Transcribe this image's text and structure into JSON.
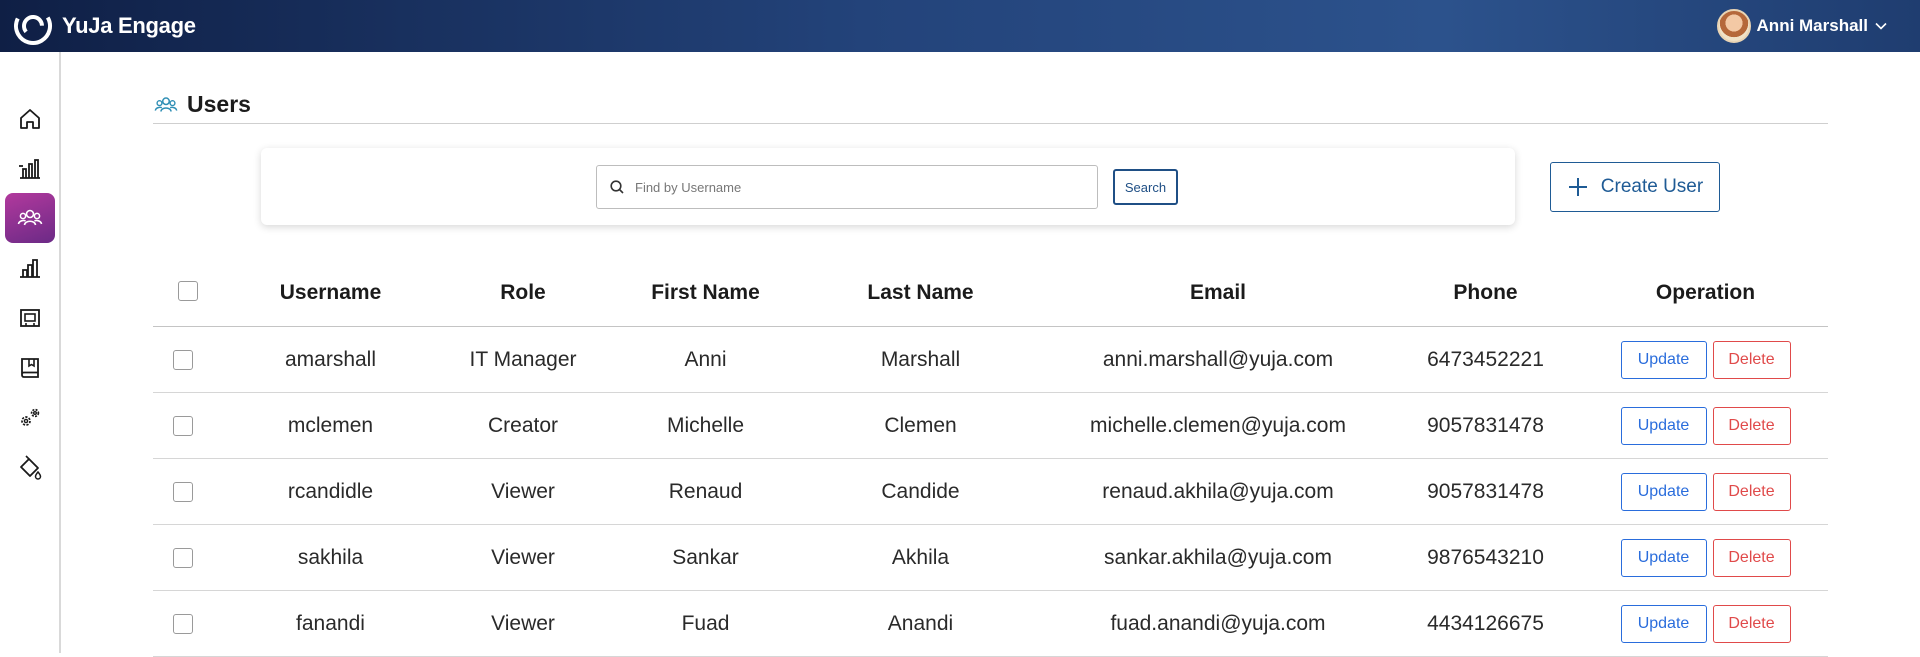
{
  "app": {
    "name": "YuJa Engage"
  },
  "user_menu": {
    "name": "Anni Marshall"
  },
  "sidebar": {
    "items": [
      {
        "name": "home",
        "icon": "home-icon",
        "active": false
      },
      {
        "name": "analytics",
        "icon": "bar-chart-building-icon",
        "active": false
      },
      {
        "name": "users",
        "icon": "users-icon",
        "active": true
      },
      {
        "name": "reports",
        "icon": "bar-chart-icon",
        "active": false
      },
      {
        "name": "courses",
        "icon": "classroom-icon",
        "active": false
      },
      {
        "name": "library",
        "icon": "book-icon",
        "active": false
      },
      {
        "name": "settings",
        "icon": "gears-icon",
        "active": false
      },
      {
        "name": "branding",
        "icon": "paint-bucket-icon",
        "active": false
      }
    ]
  },
  "page": {
    "title": "Users"
  },
  "search": {
    "placeholder": "Find by Username",
    "value": "",
    "button_label": "Search"
  },
  "create_user": {
    "label": "Create User"
  },
  "table": {
    "headers": {
      "username": "Username",
      "role": "Role",
      "first_name": "First Name",
      "last_name": "Last Name",
      "email": "Email",
      "phone": "Phone",
      "operation": "Operation"
    },
    "rows": [
      {
        "username": "amarshall",
        "role": "IT Manager",
        "first_name": "Anni",
        "last_name": "Marshall",
        "email": "anni.marshall@yuja.com",
        "phone": "6473452221"
      },
      {
        "username": "mclemen",
        "role": "Creator",
        "first_name": "Michelle",
        "last_name": "Clemen",
        "email": "michelle.clemen@yuja.com",
        "phone": "9057831478"
      },
      {
        "username": "rcandidle",
        "role": "Viewer",
        "first_name": "Renaud",
        "last_name": "Candide",
        "email": "renaud.akhila@yuja.com",
        "phone": "9057831478"
      },
      {
        "username": "sakhila",
        "role": "Viewer",
        "first_name": "Sankar",
        "last_name": "Akhila",
        "email": "sankar.akhila@yuja.com",
        "phone": "9876543210"
      },
      {
        "username": "fanandi",
        "role": "Viewer",
        "first_name": "Fuad",
        "last_name": "Anandi",
        "email": "fuad.anandi@yuja.com",
        "phone": "4434126675"
      }
    ],
    "update_label": "Update",
    "delete_label": "Delete"
  },
  "colors": {
    "topbar_start": "#0f1f45",
    "topbar_end": "#2c528c",
    "sidebar_active_start": "#b2399d",
    "sidebar_active_end": "#6b2a86",
    "primary": "#1f5b95",
    "update": "#2a6ddc",
    "delete": "#e04a4a"
  }
}
